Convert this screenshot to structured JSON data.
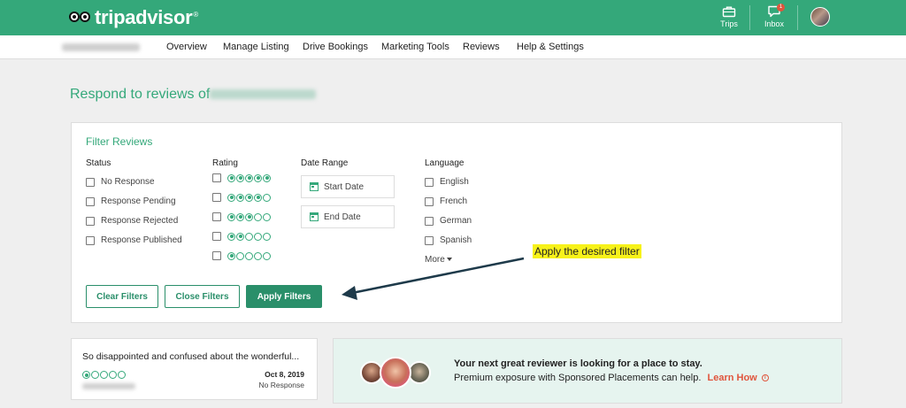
{
  "brand": {
    "name": "tripadvisor",
    "registered": "®",
    "color": "#34a87a",
    "accent": "#e0553d"
  },
  "top_actions": {
    "trips": {
      "label": "Trips",
      "icon": "briefcase-icon"
    },
    "inbox": {
      "label": "Inbox",
      "icon": "chat-icon",
      "badge": "1"
    }
  },
  "nav": {
    "items": [
      "Overview",
      "Manage Listing",
      "Drive Bookings",
      "Marketing Tools",
      "Reviews",
      "Help & Settings"
    ]
  },
  "page": {
    "heading": "Respond to reviews of"
  },
  "filter": {
    "title": "Filter Reviews",
    "status": {
      "label": "Status",
      "options": [
        "No Response",
        "Response Pending",
        "Response Rejected",
        "Response Published"
      ]
    },
    "rating": {
      "label": "Rating",
      "options": [
        5,
        4,
        3,
        2,
        1
      ],
      "max": 5
    },
    "date_range": {
      "label": "Date Range",
      "start": "Start Date",
      "end": "End Date"
    },
    "language": {
      "label": "Language",
      "options": [
        "English",
        "French",
        "German",
        "Spanish"
      ],
      "more": "More"
    },
    "buttons": {
      "clear": "Clear Filters",
      "close": "Close Filters",
      "apply": "Apply Filters"
    }
  },
  "annotation": {
    "text": "Apply the desired filter",
    "highlight": "#f7f21a"
  },
  "review": {
    "title": "So disappointed and confused about the wonderful...",
    "rating": 1,
    "date": "Oct 8, 2019",
    "status": "No Response"
  },
  "promo": {
    "title": "Your next great reviewer is looking for a place to stay.",
    "subtitle": "Premium exposure with Sponsored Placements can help.",
    "link": "Learn How"
  }
}
